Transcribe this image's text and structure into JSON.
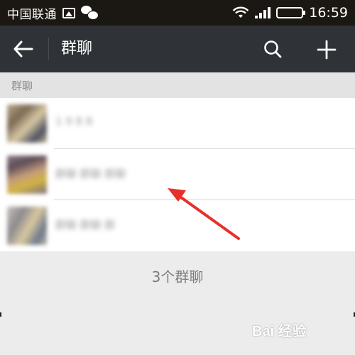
{
  "status_bar": {
    "carrier": "中国联通",
    "time": "16:59",
    "icons": [
      "image-icon",
      "wechat-icon",
      "wifi-icon",
      "signal-icon",
      "battery-icon"
    ],
    "battery_color": "#3ac53a"
  },
  "title_bar": {
    "title": "群聊",
    "back_icon": "arrow-left-icon",
    "search_icon": "search-icon",
    "add_icon": "plus-icon",
    "background": "#2f3236"
  },
  "section_header": "群聊",
  "group_list": {
    "items": [
      {
        "name": "1 9 8 8"
      },
      {
        "name": "群聊 群聊 群聊"
      },
      {
        "name": "群聊 群聊 群"
      }
    ]
  },
  "footer": {
    "count_text": "3个群聊"
  },
  "watermark": "Bai 经验"
}
